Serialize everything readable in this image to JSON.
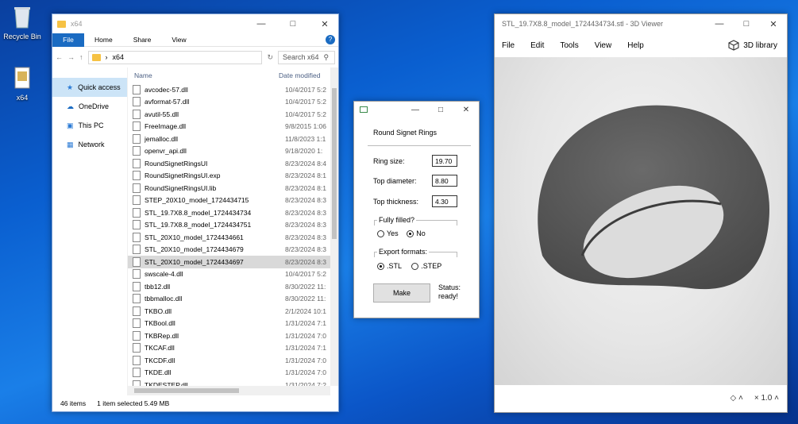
{
  "desktop": {
    "icons": [
      {
        "label": "Recycle Bin"
      },
      {
        "label": "x64"
      }
    ]
  },
  "explorer": {
    "title": "x64",
    "ribbon_tabs": [
      "File",
      "Home",
      "Share",
      "View"
    ],
    "address": "x64",
    "search_placeholder": "Search x64",
    "columns": {
      "name": "Name",
      "date": "Date modified"
    },
    "nav": [
      "Quick access",
      "OneDrive",
      "This PC",
      "Network"
    ],
    "files": [
      {
        "name": "avcodec-57.dll",
        "date": "10/4/2017 5:2"
      },
      {
        "name": "avformat-57.dll",
        "date": "10/4/2017 5:2"
      },
      {
        "name": "avutil-55.dll",
        "date": "10/4/2017 5:2"
      },
      {
        "name": "FreeImage.dll",
        "date": "9/8/2015 1:06"
      },
      {
        "name": "jemalloc.dll",
        "date": "11/8/2023 1:1"
      },
      {
        "name": "openvr_api.dll",
        "date": "9/18/2020 1:"
      },
      {
        "name": "RoundSignetRingsUI",
        "date": "8/23/2024 8:4"
      },
      {
        "name": "RoundSignetRingsUI.exp",
        "date": "8/23/2024 8:1"
      },
      {
        "name": "RoundSignetRingsUI.lib",
        "date": "8/23/2024 8:1"
      },
      {
        "name": "STEP_20X10_model_1724434715",
        "date": "8/23/2024 8:3"
      },
      {
        "name": "STL_19.7X8.8_model_1724434734",
        "date": "8/23/2024 8:3"
      },
      {
        "name": "STL_19.7X8.8_model_1724434751",
        "date": "8/23/2024 8:3"
      },
      {
        "name": "STL_20X10_model_1724434661",
        "date": "8/23/2024 8:3"
      },
      {
        "name": "STL_20X10_model_1724434679",
        "date": "8/23/2024 8:3"
      },
      {
        "name": "STL_20X10_model_1724434697",
        "date": "8/23/2024 8:3"
      },
      {
        "name": "swscale-4.dll",
        "date": "10/4/2017 5:2"
      },
      {
        "name": "tbb12.dll",
        "date": "8/30/2022 11:"
      },
      {
        "name": "tbbmalloc.dll",
        "date": "8/30/2022 11:"
      },
      {
        "name": "TKBO.dll",
        "date": "2/1/2024 10:1"
      },
      {
        "name": "TKBool.dll",
        "date": "1/31/2024 7:1"
      },
      {
        "name": "TKBRep.dll",
        "date": "1/31/2024 7:0"
      },
      {
        "name": "TKCAF.dll",
        "date": "1/31/2024 7:1"
      },
      {
        "name": "TKCDF.dll",
        "date": "1/31/2024 7:0"
      },
      {
        "name": "TKDE.dll",
        "date": "1/31/2024 7:0"
      },
      {
        "name": "TKDESTEP.dll",
        "date": "1/31/2024 7:2"
      }
    ],
    "selected_index": 14,
    "status": {
      "count": "46 items",
      "selection": "1 item selected  5.49 MB"
    }
  },
  "dialog": {
    "caption": "Round Signet Rings",
    "fields": [
      {
        "label": "Ring size:",
        "value": "19.70"
      },
      {
        "label": "Top diameter:",
        "value": "8.80"
      },
      {
        "label": "Top thickness:",
        "value": "4.30"
      }
    ],
    "fill_group": {
      "label": "Fully filled?",
      "options": [
        "Yes",
        "No"
      ],
      "selected": "No"
    },
    "export_group": {
      "label": "Export formats:",
      "options": [
        ".STL",
        ".STEP"
      ],
      "selected": ".STL"
    },
    "make_label": "Make",
    "status_label": "Status:",
    "status_value": "ready!"
  },
  "viewer": {
    "title": "STL_19.7X8.8_model_1724434734.stl - 3D Viewer",
    "menu": [
      "File",
      "Edit",
      "Tools",
      "View",
      "Help"
    ],
    "library_label": "3D library",
    "zoom": "× 1.0",
    "model_color": "#5a5a5a"
  }
}
